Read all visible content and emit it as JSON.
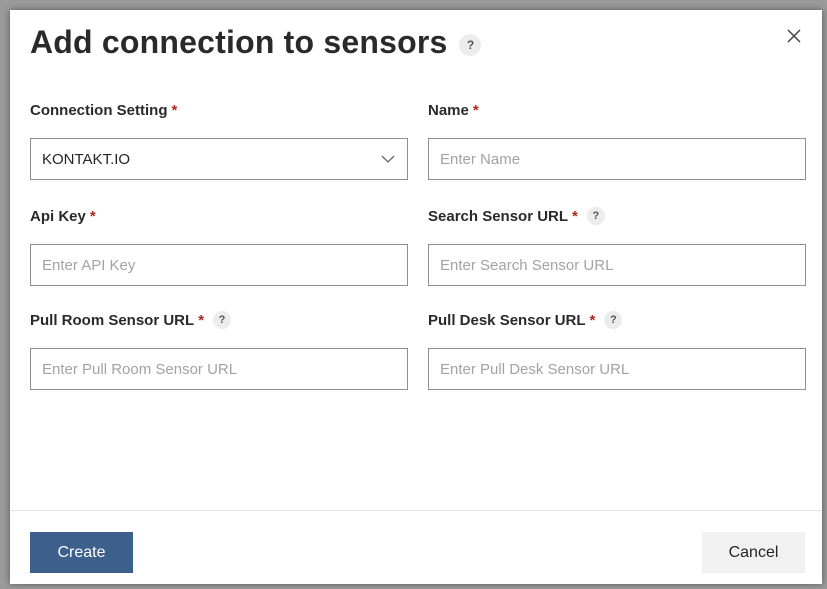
{
  "dialog": {
    "title": "Add connection to sensors",
    "help_glyph": "?",
    "close_icon": "close-icon"
  },
  "fields": {
    "connection_setting": {
      "label": "Connection Setting",
      "required_mark": "*",
      "selected_value": "KONTAKT.IO"
    },
    "name": {
      "label": "Name",
      "required_mark": "*",
      "placeholder": "Enter Name"
    },
    "api_key": {
      "label": "Api Key",
      "required_mark": "*",
      "placeholder": "Enter API Key"
    },
    "search_sensor_url": {
      "label": "Search Sensor URL",
      "required_mark": "*",
      "help_glyph": "?",
      "placeholder": "Enter Search Sensor URL"
    },
    "pull_room_sensor_url": {
      "label": "Pull Room Sensor URL",
      "required_mark": "*",
      "help_glyph": "?",
      "placeholder": "Enter Pull Room Sensor URL"
    },
    "pull_desk_sensor_url": {
      "label": "Pull Desk Sensor URL",
      "required_mark": "*",
      "help_glyph": "?",
      "placeholder": "Enter Pull Desk Sensor URL"
    }
  },
  "footer": {
    "create_label": "Create",
    "cancel_label": "Cancel"
  },
  "colors": {
    "primary_button": "#3c5f8b",
    "required_asterisk": "#b3261e",
    "input_border": "#8d8d8d"
  }
}
